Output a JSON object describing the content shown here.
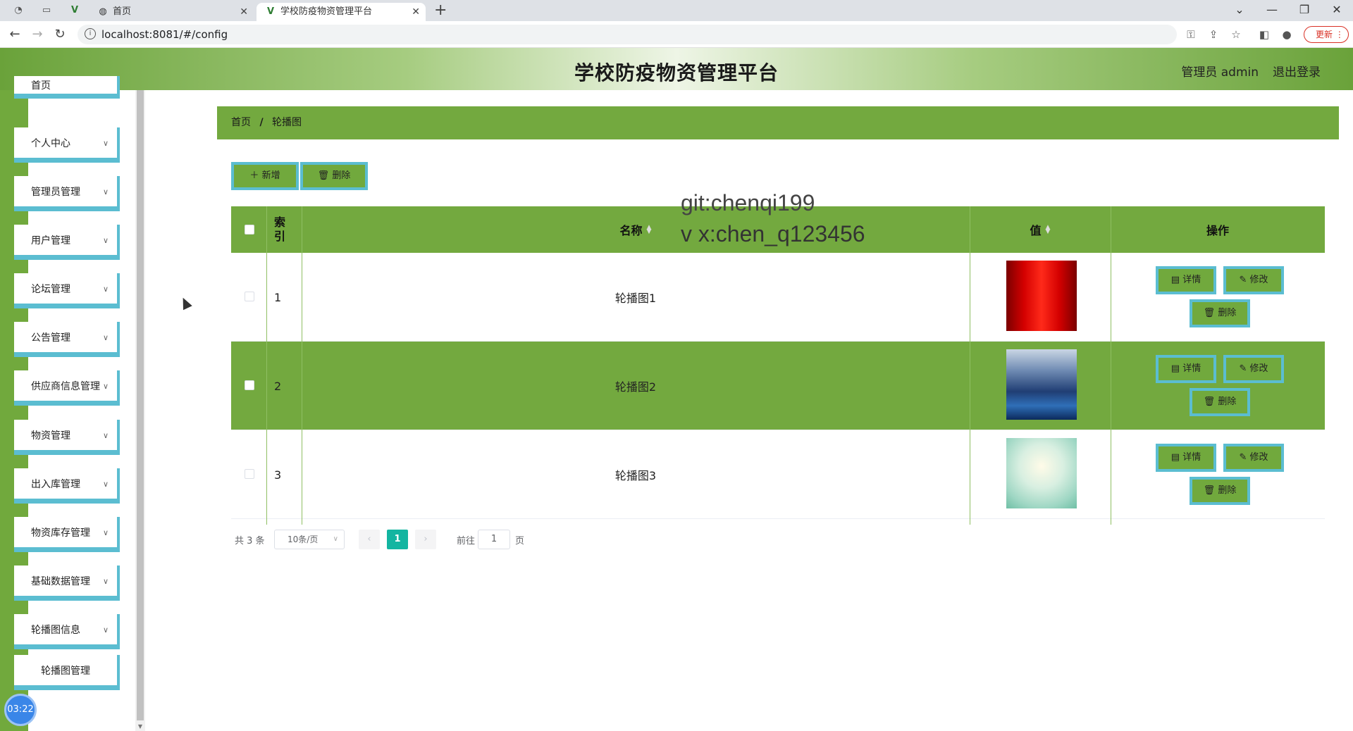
{
  "browser": {
    "tabs": [
      {
        "title": "首页",
        "active": false
      },
      {
        "title": "学校防疫物资管理平台",
        "active": true
      }
    ],
    "new_tab": "+",
    "url": "localhost:8081/#/config",
    "update_label": "更新"
  },
  "header": {
    "title": "学校防疫物资管理平台",
    "user": "管理员 admin",
    "logout": "退出登录"
  },
  "sidebar": {
    "items": [
      {
        "label": "首页",
        "expandable": false
      },
      {
        "label": "个人中心",
        "expandable": true
      },
      {
        "label": "管理员管理",
        "expandable": true
      },
      {
        "label": "用户管理",
        "expandable": true
      },
      {
        "label": "论坛管理",
        "expandable": true
      },
      {
        "label": "公告管理",
        "expandable": true
      },
      {
        "label": "供应商信息管理",
        "expandable": true
      },
      {
        "label": "物资管理",
        "expandable": true
      },
      {
        "label": "出入库管理",
        "expandable": true
      },
      {
        "label": "物资库存管理",
        "expandable": true
      },
      {
        "label": "基础数据管理",
        "expandable": true
      },
      {
        "label": "轮播图信息",
        "expandable": true
      },
      {
        "label": "轮播图管理",
        "expandable": false
      }
    ],
    "timer": "03:22"
  },
  "breadcrumb": {
    "home": "首页",
    "separator": "/",
    "current": "轮播图"
  },
  "toolbar": {
    "add_label": "新增",
    "delete_label": "删除"
  },
  "watermark": {
    "line1": "git:chenqi199",
    "line2": "v x:chen_q123456"
  },
  "table": {
    "headers": {
      "index": "索\n引",
      "name": "名称",
      "value": "值",
      "actions": "操作"
    },
    "rows": [
      {
        "index": "1",
        "name": "轮播图1",
        "image": "red-curtain-stage",
        "selected": false
      },
      {
        "index": "2",
        "name": "轮播图2",
        "image": "blue-city-skyline",
        "selected": true
      },
      {
        "index": "3",
        "name": "轮播图3",
        "image": "pale-green-floral",
        "selected": false
      }
    ],
    "actions": {
      "detail": "详情",
      "edit": "修改",
      "delete": "删除"
    }
  },
  "pagination": {
    "total": "共 3 条",
    "page_size": "10条/页",
    "current_page": "1",
    "goto_prefix": "前往",
    "goto_value": "1",
    "goto_suffix": "页"
  },
  "colors": {
    "primary_green": "#73a93f",
    "accent_cyan": "#5bbdd1",
    "pager_active": "#13b5a1"
  }
}
